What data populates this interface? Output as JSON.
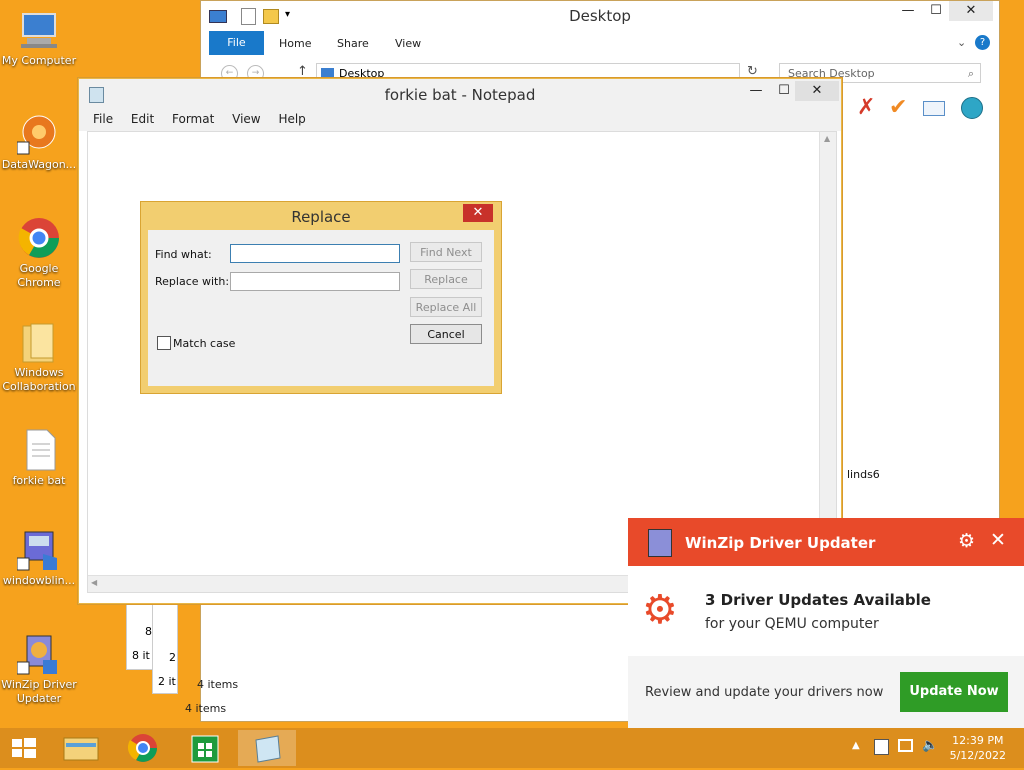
{
  "desktop": {
    "icons": [
      {
        "label": "My Computer"
      },
      {
        "label": "DataWagon..."
      },
      {
        "label": "Google Chrome"
      },
      {
        "label": "Windows Collaboration"
      },
      {
        "label": "forkie bat"
      },
      {
        "label": "windowblin..."
      },
      {
        "label": "WinZip Driver Updater"
      }
    ]
  },
  "explorer": {
    "title": "Desktop",
    "tabs": [
      "File",
      "Home",
      "Share",
      "View"
    ],
    "address": "Desktop",
    "search_placeholder": "Search Desktop",
    "side_text": "linds6",
    "items_status": "4 items",
    "items_status2": "4 items",
    "bg_windows": {
      "a_digit": "8",
      "a_status": "8 it",
      "b_digit": "2",
      "b_status": "2 it"
    }
  },
  "notepad": {
    "title": "forkie bat - Notepad",
    "menu": [
      "File",
      "Edit",
      "Format",
      "View",
      "Help"
    ]
  },
  "replace_dialog": {
    "title": "Replace",
    "find_label": "Find what:",
    "replace_label": "Replace with:",
    "find_value": "",
    "replace_value": "",
    "find_next": "Find Next",
    "replace": "Replace",
    "replace_all": "Replace All",
    "cancel": "Cancel",
    "match_case": "Match case"
  },
  "winzip": {
    "header": "WinZip Driver Updater",
    "headline": "3 Driver Updates Available",
    "subline": "for your QEMU computer",
    "prompt": "Review and update your drivers now",
    "button": "Update Now"
  },
  "taskbar": {
    "time": "12:39 PM",
    "date": "5/12/2022"
  },
  "colors": {
    "desktop_bg": "#f6a21d",
    "winzip_red": "#e84a2a",
    "update_green": "#2f9c26",
    "ribbon_blue": "#1979ca"
  }
}
